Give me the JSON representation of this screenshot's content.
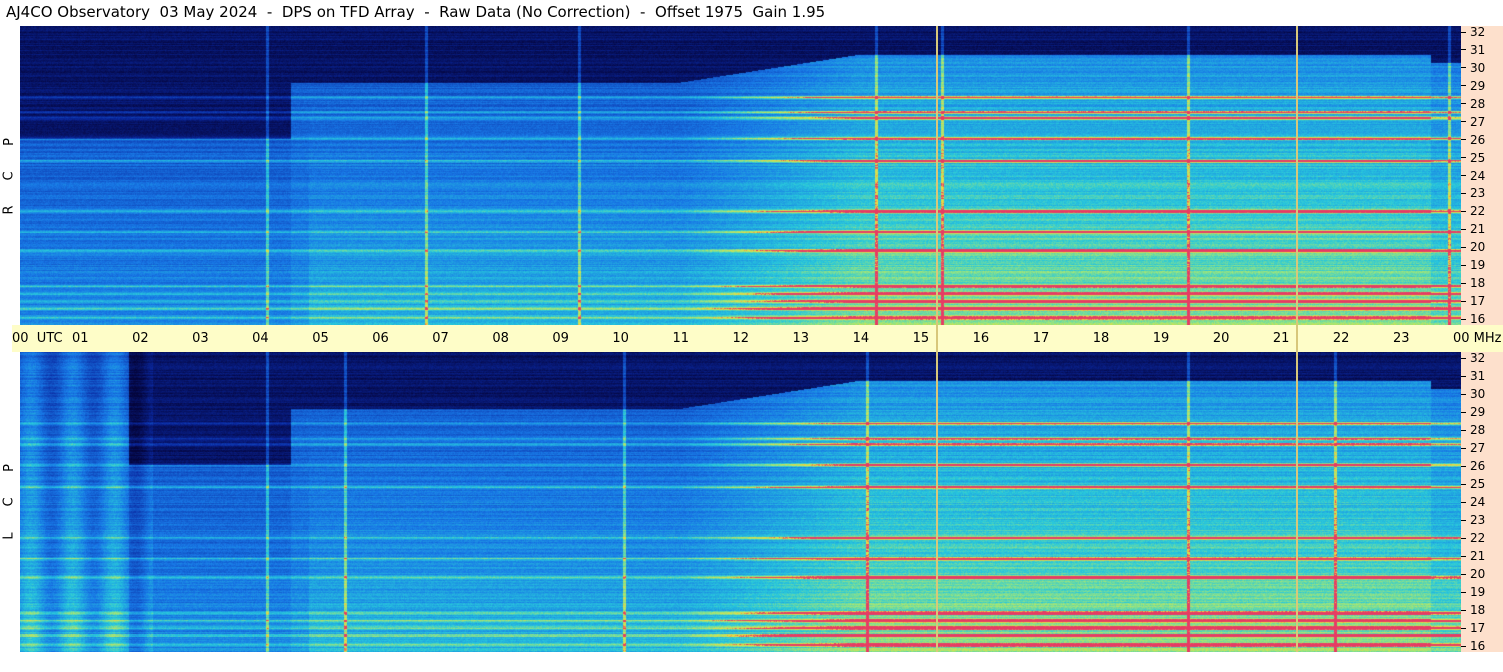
{
  "chart_data": {
    "type": "heatmap",
    "title": "AJ4CO Observatory  03 May 2024  -  DPS on TFD Array  -  Raw Data (No Correction)  -  Offset 1975  Gain 1.95",
    "panels": [
      {
        "label_letters": [
          "P",
          "C",
          "R"
        ]
      },
      {
        "label_letters": [
          "P",
          "C",
          "L"
        ]
      }
    ],
    "x_axis": {
      "ticks": [
        "00  UTC",
        "01",
        "02",
        "03",
        "04",
        "05",
        "06",
        "07",
        "08",
        "09",
        "10",
        "11",
        "12",
        "13",
        "14",
        "15",
        "16",
        "17",
        "18",
        "19",
        "20",
        "21",
        "22",
        "23",
        "00 MHz"
      ],
      "range_hours": [
        0,
        24
      ]
    },
    "y_axis": {
      "ticks": [
        "32",
        "31",
        "30",
        "29",
        "28",
        "27",
        "26",
        "25",
        "24",
        "23",
        "22",
        "21",
        "20",
        "19",
        "18",
        "17",
        "16"
      ],
      "range_mhz": [
        16,
        32
      ]
    },
    "vertical_markers_hours": [
      15.25,
      21.25
    ],
    "colors": {
      "background": "#04043a",
      "low": "#0a2a9a",
      "mid": "#1a8ce8",
      "high": "#3cd8c8",
      "hot": "#f0e040",
      "peak": "#e04060",
      "marker": "#d8c77a"
    }
  }
}
